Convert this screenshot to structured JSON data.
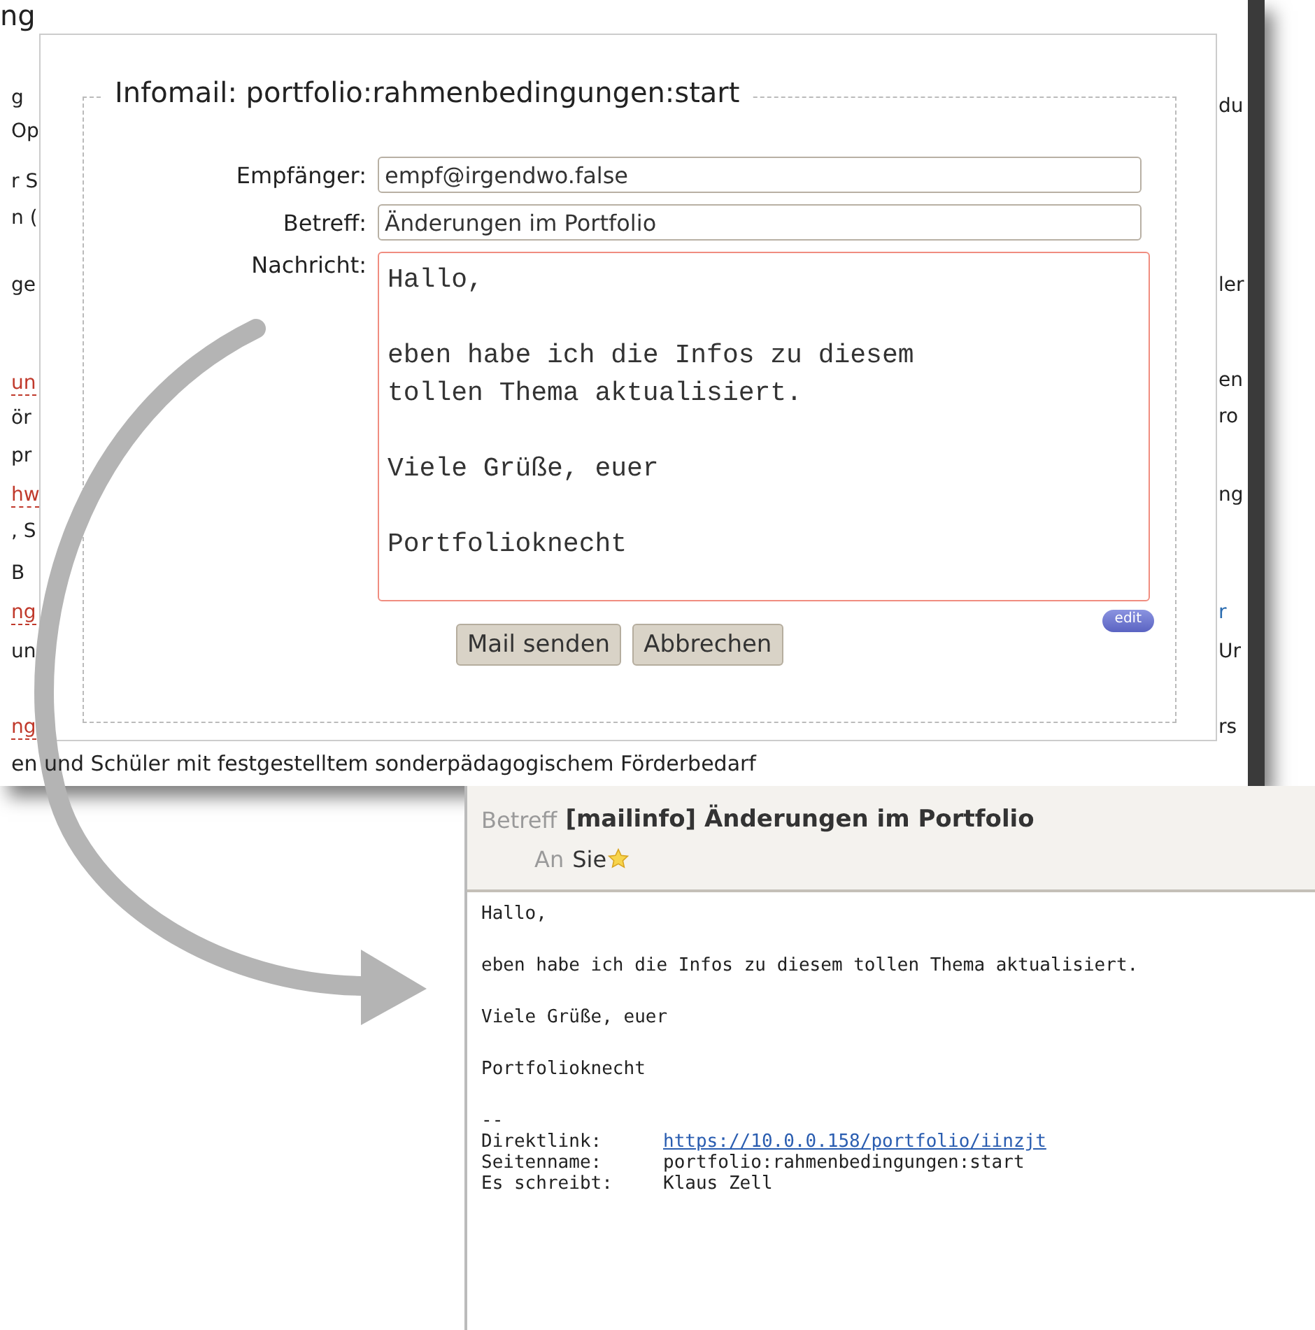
{
  "background_page": {
    "heading": "ng",
    "left_fragments": [
      "g",
      "Op",
      "r S",
      "n (",
      "ge",
      "un",
      "ör",
      "pr",
      "hw",
      ", S",
      "B",
      "ng",
      "un",
      "ng"
    ],
    "left_links": [
      false,
      false,
      false,
      false,
      false,
      true,
      false,
      false,
      true,
      false,
      false,
      true,
      false,
      true
    ],
    "right_fragments": [
      "du",
      "ler",
      "en",
      "ro",
      "ng",
      "r",
      "Ur",
      "rs"
    ],
    "right_links": [
      false,
      false,
      false,
      false,
      false,
      true,
      false,
      false
    ],
    "footer_line": "en und Schüler mit festgestelltem sonderpädagogischem Förderbedarf"
  },
  "dialog": {
    "legend": "Infomail: portfolio:rahmenbedingungen:start",
    "fields": [
      {
        "label": "Empfänger:",
        "value": "empf@irgendwo.false"
      },
      {
        "label": "Betreff:",
        "value": "Änderungen im Portfolio"
      }
    ],
    "message_label": "Nachricht:",
    "message": "Hallo,\n\neben habe ich die Infos zu diesem\ntollen Thema aktualisiert.\n\nViele Grüße, euer\n\nPortfolioknecht",
    "edit_badge": "edit",
    "buttons": [
      "Mail senden",
      "Abbrechen"
    ]
  },
  "mail": {
    "subject_label": "Betreff",
    "subject": "[mailinfo] Änderungen im Portfolio",
    "to_label": "An",
    "to": "Sie",
    "paragraphs": [
      "Hallo,",
      "eben habe ich die Infos zu diesem tollen Thema aktualisiert.",
      "Viele Grüße, euer",
      "Portfolioknecht"
    ],
    "separator": "--",
    "signature": [
      {
        "label": "Direktlink:",
        "value": "https://10.0.0.158/portfolio/iinzjt",
        "kind": "link"
      },
      {
        "label": "Seitenname:",
        "value": "portfolio:rahmenbedingungen:start",
        "kind": "text"
      },
      {
        "label": "Es schreibt:",
        "value": "Klaus Zell",
        "kind": "text"
      }
    ]
  }
}
